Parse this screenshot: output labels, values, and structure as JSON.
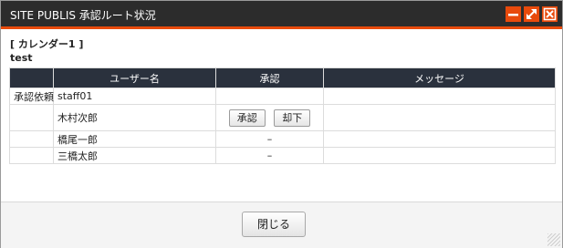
{
  "window": {
    "title": "SITE PUBLIS 承認ルート状況",
    "buttons": [
      {
        "name": "minimize-icon"
      },
      {
        "name": "maximize-icon"
      },
      {
        "name": "close-icon"
      }
    ],
    "accent_color": "#e84a0c",
    "titlebar_color": "#2c2c2c"
  },
  "content": {
    "calendar_title": "[ カレンダー1 ]",
    "subtitle": "test"
  },
  "table": {
    "columns": [
      "",
      "ユーザー名",
      "承認",
      "メッセージ"
    ],
    "rows": [
      {
        "role": "承認依頼",
        "user": "staff01",
        "approval": "",
        "message": ""
      },
      {
        "role": "",
        "user": "木村次郎",
        "approval": "",
        "message": "",
        "buttons": [
          "承認",
          "却下"
        ]
      },
      {
        "role": "",
        "user": "橋尾一郎",
        "approval": "–",
        "message": ""
      },
      {
        "role": "",
        "user": "三橋太郎",
        "approval": "–",
        "message": ""
      }
    ]
  },
  "footer": {
    "close_label": "閉じる"
  }
}
